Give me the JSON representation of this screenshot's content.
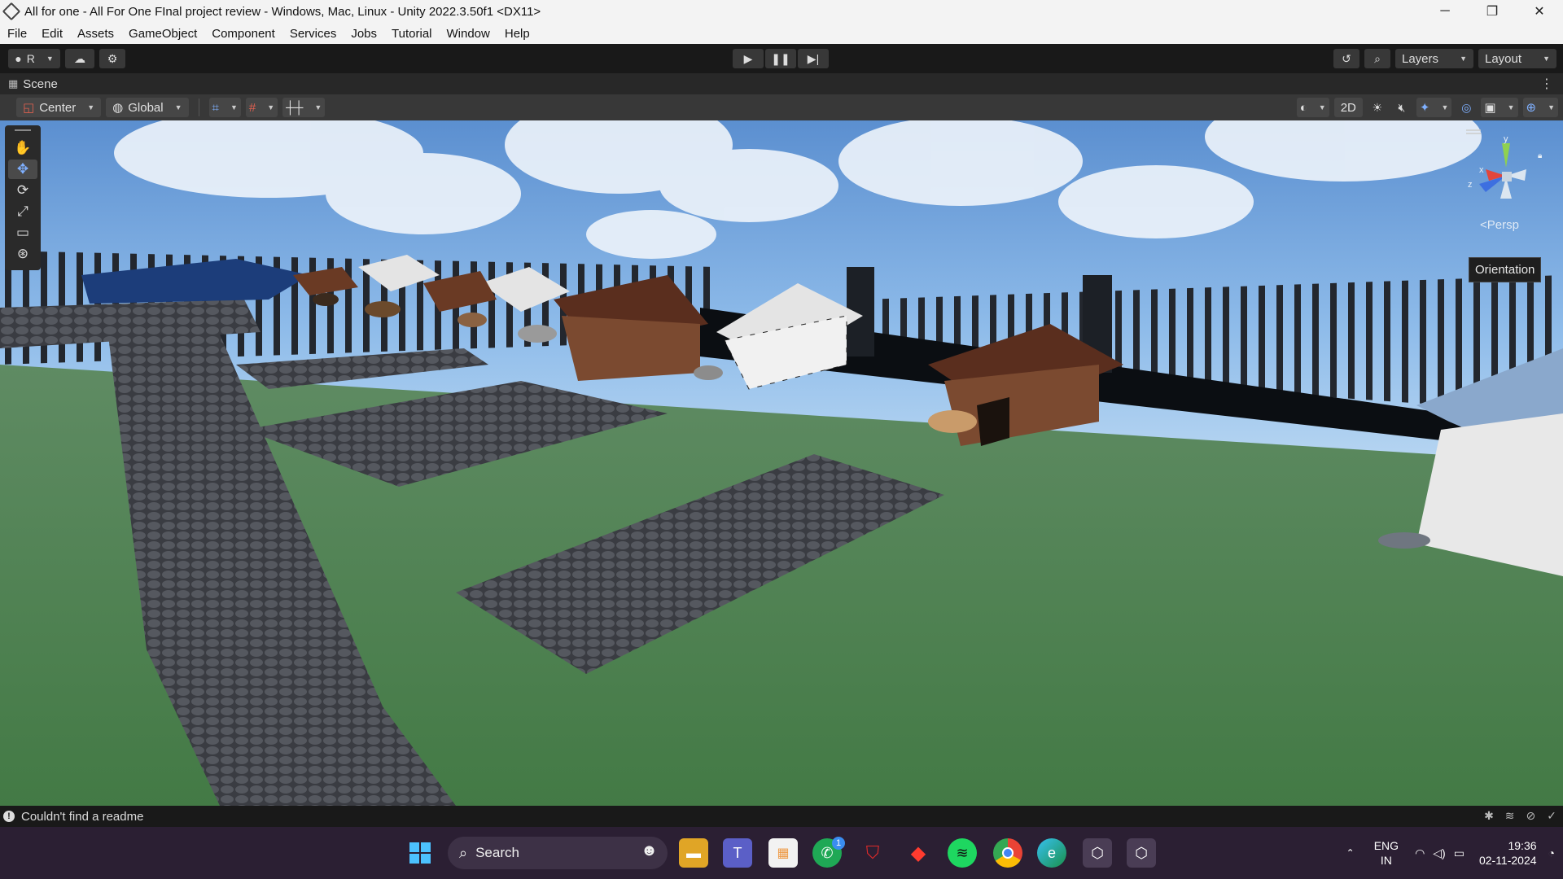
{
  "window": {
    "title": "All for one - All For One FInal project review - Windows, Mac, Linux - Unity 2022.3.50f1 <DX11>",
    "minimize": "─",
    "maximize": "❐",
    "close": "✕"
  },
  "menu": [
    "File",
    "Edit",
    "Assets",
    "GameObject",
    "Component",
    "Services",
    "Jobs",
    "Tutorial",
    "Window",
    "Help"
  ],
  "toolbar": {
    "account_label": "R",
    "layers_label": "Layers",
    "layout_label": "Layout"
  },
  "scene_tab": {
    "label": "Scene"
  },
  "scene_toolbar": {
    "pivot_label": "Center",
    "space_label": "Global",
    "mode_2d_label": "2D"
  },
  "viewport": {
    "persp_label": "<Persp",
    "orientation_tooltip": "Orientation",
    "gizmo_axes": {
      "x": "x",
      "y": "y",
      "z": "z"
    }
  },
  "status": {
    "message": "Couldn't find a readme"
  },
  "taskbar": {
    "search_placeholder": "Search",
    "whatsapp_badge": "1",
    "language": "ENG",
    "region": "IN",
    "time": "19:36",
    "date": "02-11-2024"
  },
  "colors": {
    "sky_top": "#6f9fd6",
    "grass": "#4d7a4e",
    "taskbar_bg": "#2b1f33",
    "editor_dark": "#191919"
  }
}
